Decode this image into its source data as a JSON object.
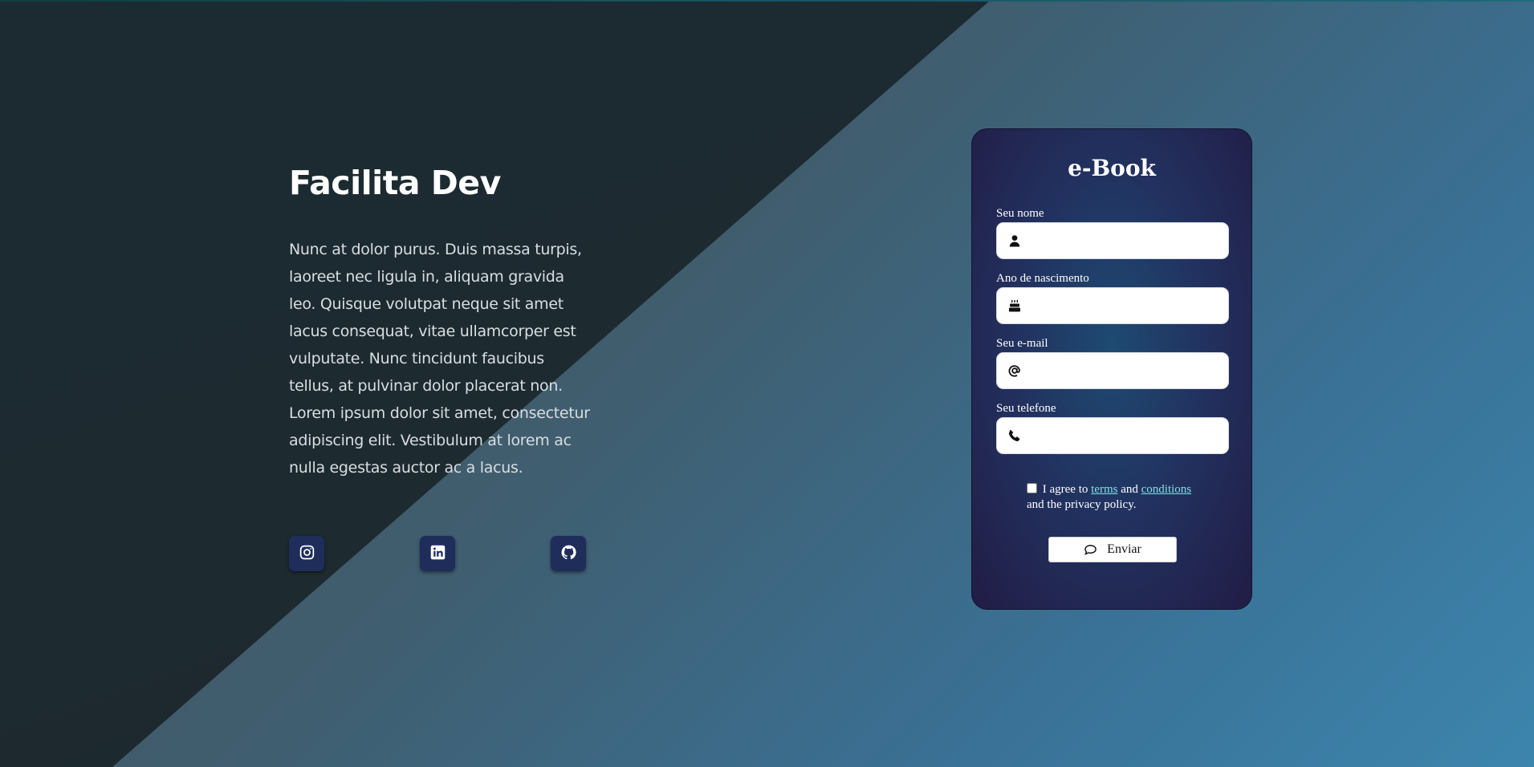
{
  "hero": {
    "title": "Facilita Dev",
    "description": "Nunc at dolor purus. Duis massa turpis, laoreet nec ligula in, aliquam gravida leo. Quisque volutpat neque sit amet lacus consequat, vitae ullamcorper est vulputate. Nunc tincidunt faucibus tellus, at pulvinar dolor placerat non. Lorem ipsum dolor sit amet, consectetur adipiscing elit. Vestibulum at lorem ac nulla egestas auctor ac a lacus."
  },
  "socials": [
    {
      "icon": "instagram-icon"
    },
    {
      "icon": "linkedin-icon"
    },
    {
      "icon": "github-icon"
    }
  ],
  "form": {
    "title": "e-Book",
    "fields": [
      {
        "label": "Seu nome",
        "icon": "user-icon",
        "value": ""
      },
      {
        "label": "Ano de nascimento",
        "icon": "birthday-cake-icon",
        "value": ""
      },
      {
        "label": "Seu e-mail",
        "icon": "at-sign-icon",
        "value": ""
      },
      {
        "label": "Seu telefone",
        "icon": "phone-icon",
        "value": ""
      }
    ],
    "agree": {
      "prefix": "I agree to",
      "terms": "terms",
      "and": "and",
      "conditions": "conditions",
      "suffix": "and the privacy policy.",
      "checked": false
    },
    "submit_label": "Enviar",
    "submit_icon": "chat-bubble-icon"
  },
  "colors": {
    "link": "#7fe0e0",
    "social_bg": "#1f2d5a",
    "card_bg": "#22305e"
  }
}
